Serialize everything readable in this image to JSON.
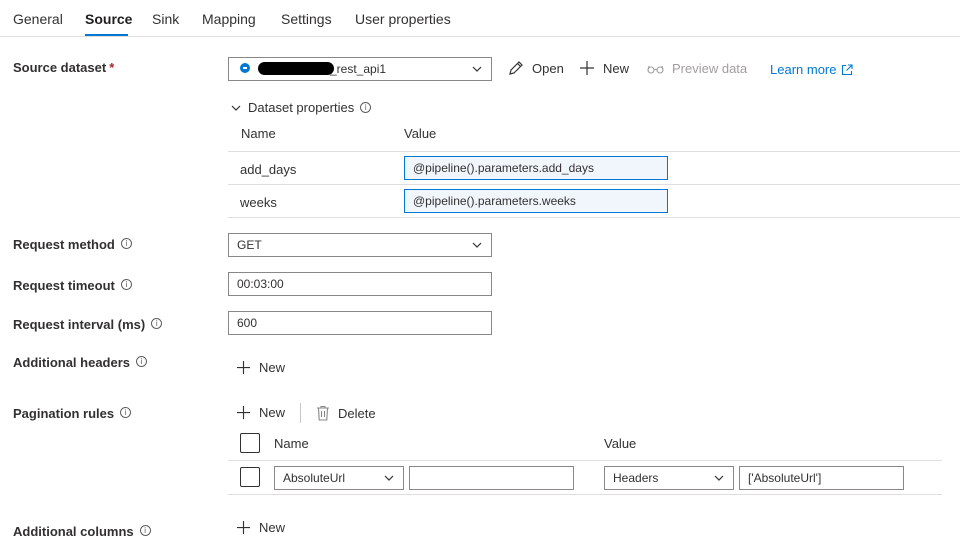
{
  "tabs": [
    {
      "label": "General"
    },
    {
      "label": "Source"
    },
    {
      "label": "Sink"
    },
    {
      "label": "Mapping"
    },
    {
      "label": "Settings"
    },
    {
      "label": "User properties"
    }
  ],
  "active_tab": "Source",
  "source_dataset": {
    "label": "Source dataset",
    "required_mark": "*",
    "value_suffix": "_rest_api1",
    "open_label": "Open",
    "new_label": "New",
    "preview_label": "Preview data",
    "learn_more_label": "Learn more"
  },
  "dataset_properties": {
    "title": "Dataset properties",
    "col_name": "Name",
    "col_value": "Value",
    "rows": [
      {
        "name": "add_days",
        "value": "@pipeline().parameters.add_days"
      },
      {
        "name": "weeks",
        "value": "@pipeline().parameters.weeks"
      }
    ]
  },
  "request_method": {
    "label": "Request method",
    "value": "GET"
  },
  "request_timeout": {
    "label": "Request timeout",
    "value": "00:03:00"
  },
  "request_interval": {
    "label": "Request interval (ms)",
    "value": "600"
  },
  "additional_headers": {
    "label": "Additional headers",
    "new_label": "New"
  },
  "pagination_rules": {
    "label": "Pagination rules",
    "new_label": "New",
    "delete_label": "Delete",
    "col_name": "Name",
    "col_value": "Value",
    "row": {
      "name_select": "AbsoluteUrl",
      "name_input": "",
      "value_select": "Headers",
      "value_input": "['AbsoluteUrl']"
    }
  },
  "additional_columns": {
    "label": "Additional columns",
    "new_label": "New"
  },
  "info_glyph": "i",
  "colors": {
    "accent": "#0078d4",
    "text": "#323130",
    "disabled": "#a19f9d",
    "required": "#a4262c"
  }
}
